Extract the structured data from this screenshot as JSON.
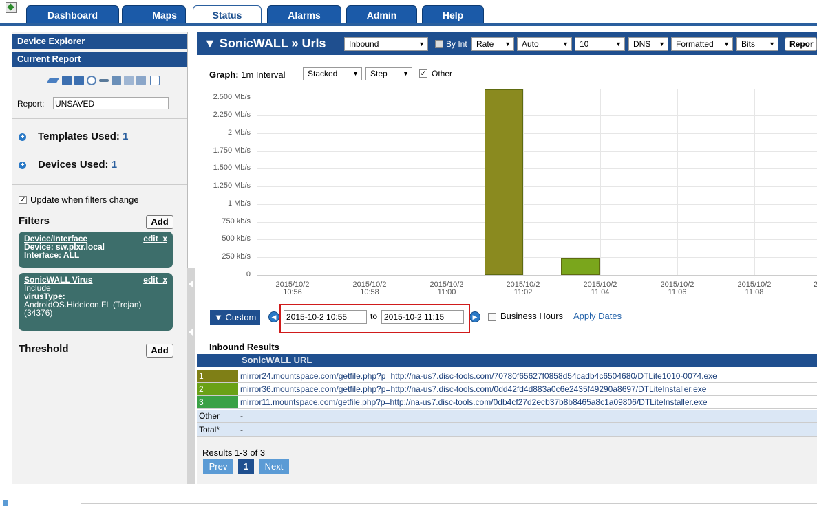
{
  "tabs": [
    {
      "label": "Dashboard",
      "active": false
    },
    {
      "label": "Maps",
      "active": false
    },
    {
      "label": "Status",
      "active": true
    },
    {
      "label": "Alarms",
      "active": false
    },
    {
      "label": "Admin",
      "active": false
    },
    {
      "label": "Help",
      "active": false
    }
  ],
  "sidebar": {
    "device_explorer": "Device Explorer",
    "current_report": "Current Report",
    "report_label": "Report:",
    "report_value": "UNSAVED",
    "templates_label": "Templates Used:",
    "templates_count": "1",
    "devices_label": "Devices Used:",
    "devices_count": "1",
    "update_label": "Update when filters change",
    "filters_title": "Filters",
    "add_label": "Add",
    "filter1": {
      "title": "Device/Interface",
      "edit": "edit",
      "remove": "x",
      "line1": "Device: sw.plxr.local",
      "line2": "Interface: ALL"
    },
    "filter2": {
      "title": "SonicWALL Virus",
      "edit": "edit",
      "remove": "x",
      "line1": "Include",
      "line2": "virusType:",
      "line3": "AndroidOS.Hideicon.FL (Trojan)",
      "line4": "(34376)"
    },
    "threshold_title": "Threshold",
    "threshold_add": "Add"
  },
  "header": {
    "title": "▼ SonicWALL » Urls",
    "direction": "Inbound",
    "by_int": "By Int",
    "rate": "Rate",
    "auto": "Auto",
    "count": "10",
    "dns": "DNS",
    "format": "Formatted",
    "units": "Bits",
    "report_btn": "Repor"
  },
  "graph": {
    "label": "Graph:",
    "interval": "1m Interval",
    "stack_mode": "Stacked",
    "line_mode": "Step",
    "other_label": "Other"
  },
  "chart_data": {
    "type": "bar",
    "ylabel": "",
    "y_tick_labels": [
      "2.500 Mb/s",
      "2.250 Mb/s",
      "2 Mb/s",
      "1.750 Mb/s",
      "1.500 Mb/s",
      "1.250 Mb/s",
      "1 Mb/s",
      "750 kb/s",
      "500 kb/s",
      "250 kb/s",
      "0"
    ],
    "x_tick_labels": [
      {
        "date": "2015/10/2",
        "time": "10:56"
      },
      {
        "date": "2015/10/2",
        "time": "10:58"
      },
      {
        "date": "2015/10/2",
        "time": "11:00"
      },
      {
        "date": "2015/10/2",
        "time": "11:02"
      },
      {
        "date": "2015/10/2",
        "time": "11:04"
      },
      {
        "date": "2015/10/2",
        "time": "11:06"
      },
      {
        "date": "2015/10/2",
        "time": "11:08"
      },
      {
        "date": "2",
        "time": ""
      }
    ],
    "ylim_mbps": [
      0,
      2.62
    ],
    "bars": [
      {
        "minute": "11:02",
        "value_mbps": 2.62,
        "color": "#8a8a1f"
      },
      {
        "minute": "11:04",
        "value_mbps": 0.24,
        "color": "#7aa61c"
      }
    ],
    "grid": true
  },
  "daterange": {
    "custom_label": "▼ Custom",
    "from": "2015-10-2 10:55",
    "to_label": "to",
    "to": "2015-10-2 11:15",
    "business_hours": "Business Hours",
    "apply": "Apply Dates"
  },
  "results": {
    "title": "Inbound Results",
    "column": "SonicWALL URL",
    "rows": [
      {
        "rank": "1",
        "color": "#7f7f16",
        "url": "mirror24.mountspace.com/getfile.php?p=http://na-us7.disc-tools.com/70780f65627f0858d54cadb4c6504680/DTLite1010-0074.exe"
      },
      {
        "rank": "2",
        "color": "#6aa116",
        "url": "mirror36.mountspace.com/getfile.php?p=http://na-us7.disc-tools.com/0dd42fd4d883a0c6e2435f49290a8697/DTLiteInstaller.exe"
      },
      {
        "rank": "3",
        "color": "#3aa145",
        "url": "mirror11.mountspace.com/getfile.php?p=http://na-us7.disc-tools.com/0db4cf27d2ecb37b8b8465a8c1a09806/DTLiteInstaller.exe"
      }
    ],
    "other_label": "Other",
    "other_value": "-",
    "total_label": "Total*",
    "total_value": "-",
    "summary": "Results 1-3 of 3",
    "prev": "Prev",
    "page": "1",
    "next": "Next"
  }
}
